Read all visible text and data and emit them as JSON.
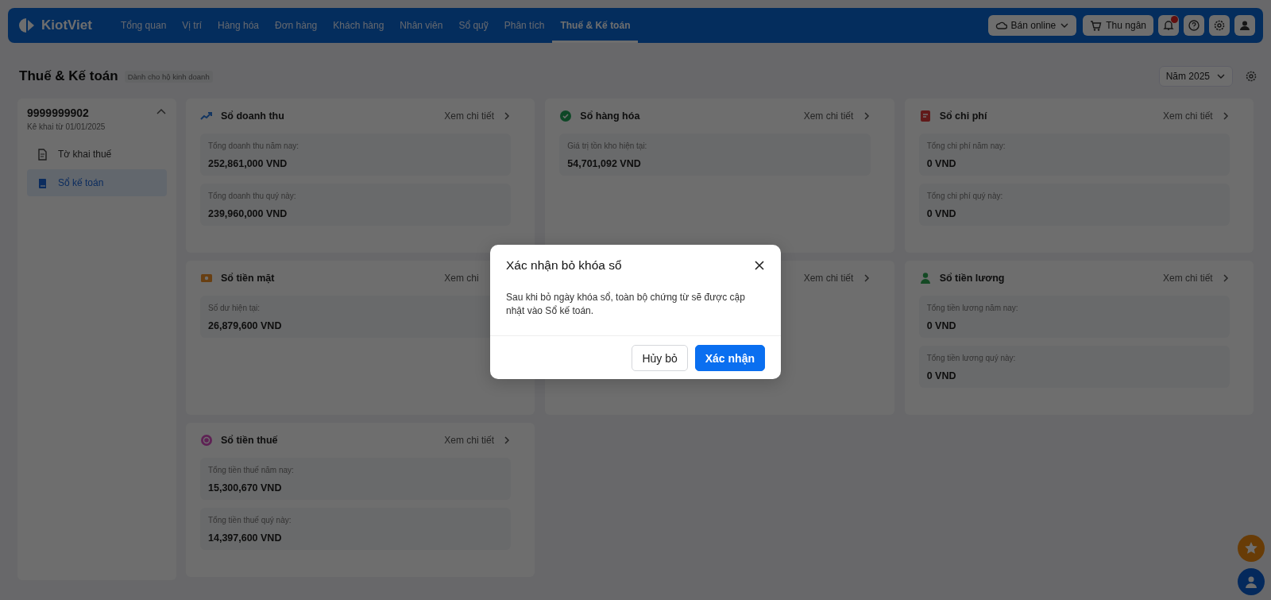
{
  "nav": {
    "logo": "KiotViet",
    "items": [
      {
        "label": "Tổng quan",
        "selected": false
      },
      {
        "label": "Vị trí",
        "selected": false
      },
      {
        "label": "Hàng hóa",
        "selected": false
      },
      {
        "label": "Đơn hàng",
        "selected": false
      },
      {
        "label": "Khách hàng",
        "selected": false
      },
      {
        "label": "Nhân viên",
        "selected": false
      },
      {
        "label": "Sổ quỹ",
        "selected": false
      },
      {
        "label": "Phân tích",
        "selected": false
      },
      {
        "label": "Thuế & Kế toán",
        "selected": true
      }
    ],
    "online_button": "Bán online",
    "cashier_button": "Thu ngân"
  },
  "page": {
    "title": "Thuế & Kế toán",
    "subtitle": "Dành cho hộ kinh doanh",
    "year_select": "Năm 2025"
  },
  "sidebar": {
    "code": "9999999902",
    "period": "Kê khai từ 01/01/2025",
    "expanded": true,
    "items": [
      {
        "label": "Tờ khai thuế",
        "kind": "document",
        "selected": false
      },
      {
        "label": "Sổ kế toán",
        "kind": "book",
        "selected": true
      }
    ]
  },
  "cards": [
    {
      "title": "Sổ doanh thu",
      "kind": "chart",
      "link": "Xem chi tiết",
      "stats": [
        {
          "label": "Tổng doanh thu năm nay:",
          "value": "252,861,000 VND"
        },
        {
          "label": "Tổng doanh thu quý này:",
          "value": "239,960,000 VND"
        }
      ]
    },
    {
      "title": "Sổ hàng hóa",
      "kind": "box",
      "link": "Xem chi tiết",
      "stats": [
        {
          "label": "Giá trị tồn kho hiện tại:",
          "value": "54,701,092 VND"
        }
      ]
    },
    {
      "title": "Sổ chi phí",
      "kind": "receipt",
      "link": "Xem chi tiết",
      "stats": [
        {
          "label": "Tổng chi phí năm nay:",
          "value": "0 VND"
        },
        {
          "label": "Tổng chi phí quý này:",
          "value": "0 VND"
        }
      ]
    },
    {
      "title": "Sổ tiền mặt",
      "kind": "cash",
      "link": "Xem chi",
      "stats": [
        {
          "label": "Số dư hiện tại:",
          "value": "26,879,600 VND"
        }
      ]
    },
    {
      "link": "Xem chi tiết"
    },
    {
      "title": "Sổ tiền lương",
      "kind": "person",
      "link": "Xem chi tiết",
      "stats": [
        {
          "label": "Tổng tiền lương năm nay:",
          "value": "0 VND"
        },
        {
          "label": "Tổng tiền lương quý này:",
          "value": "0 VND"
        }
      ]
    },
    {
      "title": "Sổ tiền thuế",
      "kind": "coin",
      "link": "Xem chi tiết",
      "stats": [
        {
          "label": "Tổng tiền thuế năm nay:",
          "value": "15,300,670 VND"
        },
        {
          "label": "Tổng tiền thuế quý này:",
          "value": "14,397,600 VND"
        }
      ]
    }
  ],
  "dialog": {
    "title": "Xác nhận bỏ khóa sổ",
    "message": "Sau khi bỏ ngày khóa sổ, toàn bộ chứng từ sẽ được cập nhật vào Sổ kế toán.",
    "cancel": "Hủy bỏ",
    "confirm": "Xác nhận"
  }
}
